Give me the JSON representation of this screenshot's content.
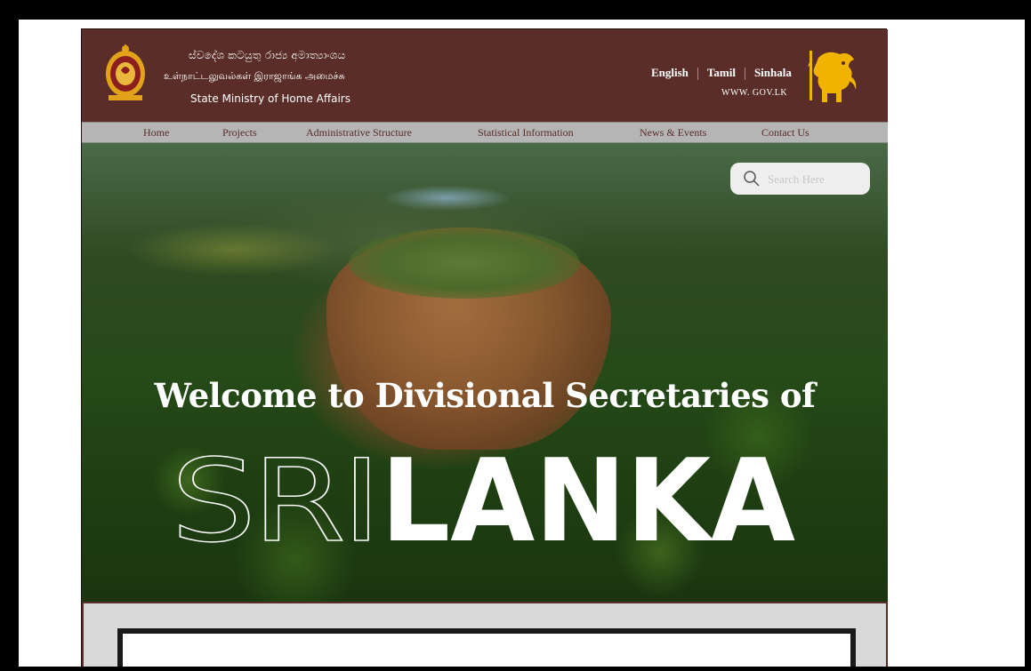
{
  "header": {
    "ministry_sinhala": "ස්වදේශ කටයුතු රාජ්‍ය අමාත්‍යාංශය",
    "ministry_tamil": "உள்நாட்டலுவல்கள் இராஜாங்க அமைச்சு",
    "ministry_english": "State Ministry of Home Affairs",
    "languages": [
      "English",
      "Tamil",
      "Sinhala"
    ],
    "gov_link": "WWW. GOV.LK",
    "emblem_icon": "sri-lanka-emblem-icon",
    "lion_icon": "lion-flag-icon"
  },
  "nav": {
    "items": [
      "Home",
      "Projects",
      "Administrative Structure",
      "Statistical Information",
      "News & Events",
      "Contact Us"
    ]
  },
  "hero": {
    "search_placeholder": "Search Here",
    "welcome": "Welcome to Divisional Secretaries of",
    "title_part1": "SRI",
    "title_part2": "LANKA"
  },
  "colors": {
    "brand": "#5a2d28",
    "nav_bg": "#b5b5b5",
    "accent": "#f0b400"
  }
}
